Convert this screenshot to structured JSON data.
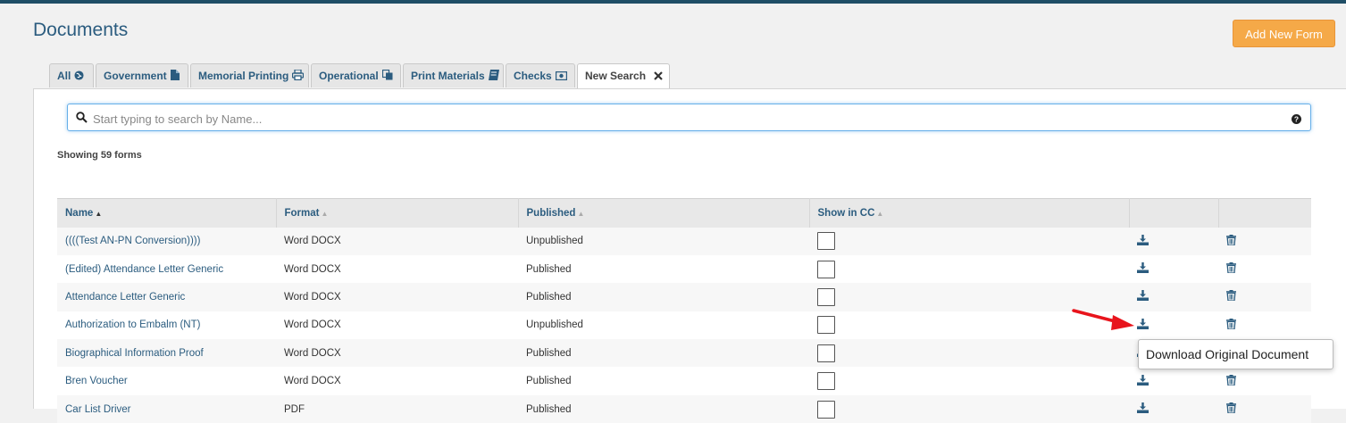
{
  "page": {
    "title": "Documents",
    "add_button": "Add New Form"
  },
  "tabs": [
    {
      "label": "All",
      "icon": "globe-icon"
    },
    {
      "label": "Government",
      "icon": "file-icon"
    },
    {
      "label": "Memorial Printing",
      "icon": "print-icon"
    },
    {
      "label": "Operational",
      "icon": "copy-icon"
    },
    {
      "label": "Print Materials",
      "icon": "book-icon"
    },
    {
      "label": "Checks",
      "icon": "money-icon"
    },
    {
      "label": "New Search",
      "icon": "close-icon",
      "active": true
    }
  ],
  "search": {
    "placeholder": "Start typing to search by Name..."
  },
  "summary": "Showing 59 forms",
  "table": {
    "columns": [
      "Name",
      "Format",
      "Published",
      "Show in CC",
      "",
      ""
    ],
    "rows": [
      {
        "name": "((((Test AN-PN Conversion))))",
        "format": "Word DOCX",
        "published": "Unpublished",
        "show_in_cc": false
      },
      {
        "name": "(Edited) Attendance Letter Generic",
        "format": "Word DOCX",
        "published": "Published",
        "show_in_cc": false
      },
      {
        "name": "Attendance Letter Generic",
        "format": "Word DOCX",
        "published": "Published",
        "show_in_cc": false
      },
      {
        "name": "Authorization to Embalm (NT)",
        "format": "Word DOCX",
        "published": "Unpublished",
        "show_in_cc": false
      },
      {
        "name": "Biographical Information Proof",
        "format": "Word DOCX",
        "published": "Published",
        "show_in_cc": false
      },
      {
        "name": "Bren Voucher",
        "format": "Word DOCX",
        "published": "Published",
        "show_in_cc": false
      },
      {
        "name": "Car List Driver",
        "format": "PDF",
        "published": "Published",
        "show_in_cc": false
      }
    ]
  },
  "tooltip": "Download Original Document",
  "colors": {
    "accent": "#2b5c7f",
    "button": "#f5a948",
    "arrow": "#e8141c"
  }
}
